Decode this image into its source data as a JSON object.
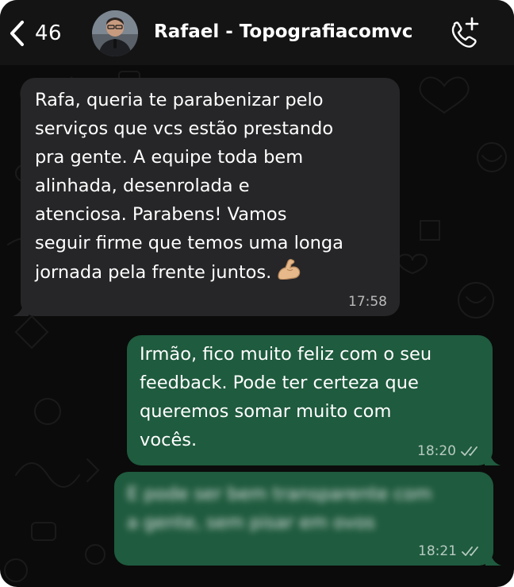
{
  "header": {
    "back_count": "46",
    "contact_name": "Rafael - Topografiacomvc"
  },
  "messages": [
    {
      "direction": "incoming",
      "text": "Rafa, queria te parabenizar pelo\nserviços que vcs estão prestando\npra gente. A equipe toda bem\nalinhada, desenrolada e\natenciosa. Parabens! Vamos\nseguir firme que temos uma longa\njornada pela frente juntos.",
      "emoji": "flexed-biceps",
      "time": "17:58"
    },
    {
      "direction": "outgoing",
      "text": "Irmão, fico muito feliz com o seu\nfeedback. Pode ter certeza que\nqueremos somar muito com\nvocês.",
      "time": "18:20",
      "status": "read"
    },
    {
      "direction": "outgoing",
      "text": "E pode ser bem transparente com\na gente, sem pisar em ovos",
      "blurred": true,
      "time": "18:21",
      "status": "read"
    }
  ],
  "colors": {
    "background": "#0b0b0b",
    "header": "#141414",
    "incoming_bubble": "#262628",
    "outgoing_bubble": "#1f5b3e"
  },
  "icons": {
    "back": "chevron-left-icon",
    "call": "phone-add-icon",
    "read_receipt": "double-check-icon"
  }
}
